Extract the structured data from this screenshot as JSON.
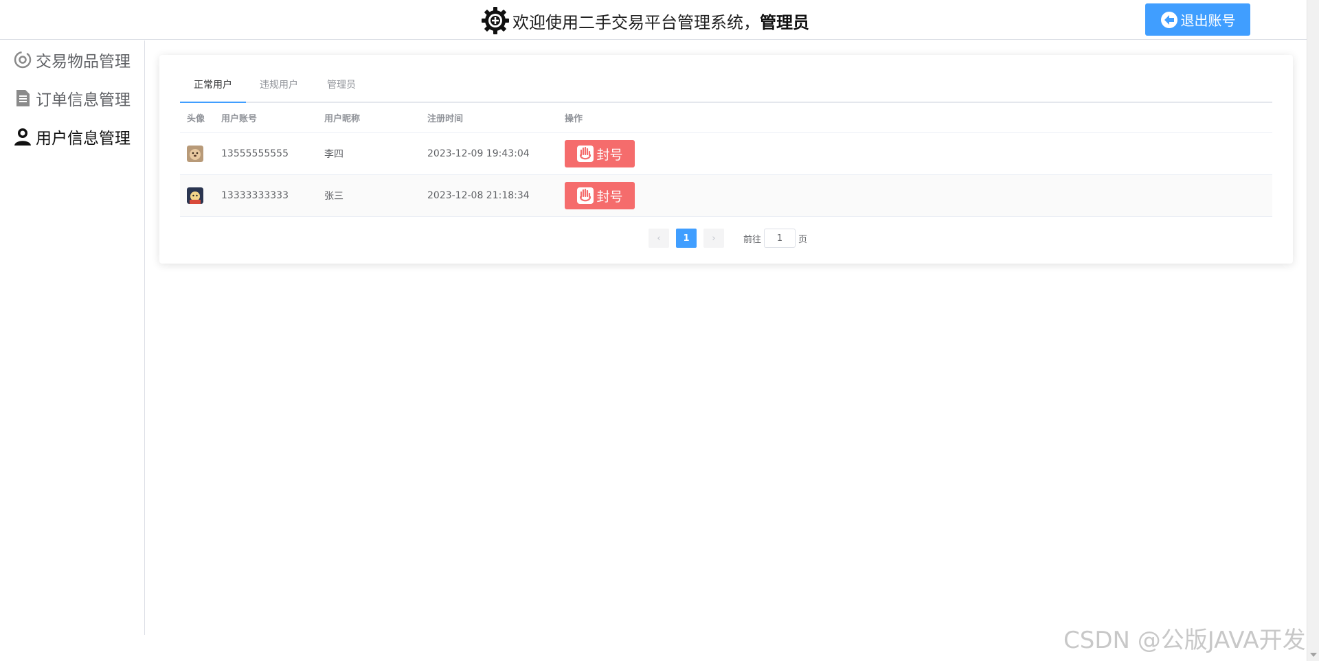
{
  "header": {
    "title_prefix": "欢迎使用二手交易平台管理系统，",
    "title_user": "管理员",
    "logout_label": "退出账号",
    "accent_color": "#409eff"
  },
  "sidebar": {
    "items": [
      {
        "label": "交易物品管理",
        "icon": "items-icon"
      },
      {
        "label": "订单信息管理",
        "icon": "document-icon"
      },
      {
        "label": "用户信息管理",
        "icon": "user-icon",
        "active": true
      }
    ]
  },
  "tabs": [
    {
      "label": "正常用户",
      "active": true
    },
    {
      "label": "违规用户"
    },
    {
      "label": "管理员"
    }
  ],
  "table": {
    "columns": [
      "头像",
      "用户账号",
      "用户昵称",
      "注册时间",
      "操作"
    ],
    "rows": [
      {
        "account": "13555555555",
        "nickname": "李四",
        "registered": "2023-12-09 19:43:04",
        "action": "封号"
      },
      {
        "account": "13333333333",
        "nickname": "张三",
        "registered": "2023-12-08 21:18:34",
        "action": "封号"
      }
    ],
    "ban_color": "#f56c6c"
  },
  "pagination": {
    "current_page": "1",
    "goto_prefix": "前往",
    "goto_value": "1",
    "goto_suffix": "页"
  },
  "watermark": "CSDN @公版JAVA开发"
}
